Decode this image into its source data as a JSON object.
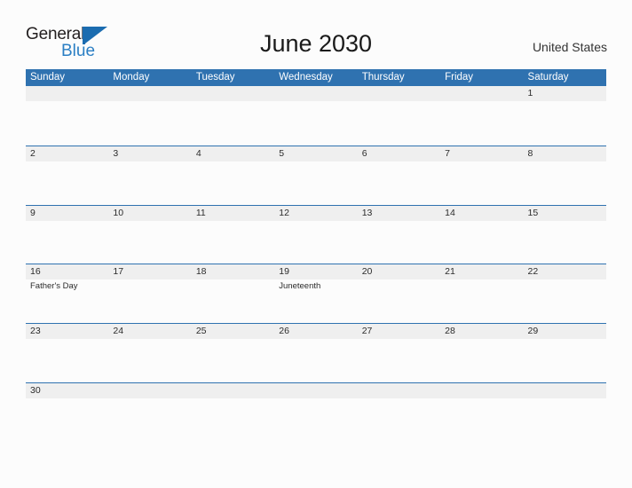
{
  "brand": {
    "name_part1": "General",
    "name_part2": "Blue",
    "mark": "triangle-flag-logo"
  },
  "header": {
    "title": "June 2030",
    "country": "United States"
  },
  "colors": {
    "header_blue": "#2f72b0",
    "row_line_blue": "#2f72b0",
    "daynum_band_gray": "#efefef",
    "logo_blue": "#2b7fc4",
    "page_background": "#fcfcfc",
    "text_dark": "#2b2b2b"
  },
  "calendar": {
    "month": "June",
    "year": "2030",
    "weekday_headers": [
      "Sunday",
      "Monday",
      "Tuesday",
      "Wednesday",
      "Thursday",
      "Friday",
      "Saturday"
    ],
    "weeks": [
      {
        "days": [
          {
            "num": "",
            "events": []
          },
          {
            "num": "",
            "events": []
          },
          {
            "num": "",
            "events": []
          },
          {
            "num": "",
            "events": []
          },
          {
            "num": "",
            "events": []
          },
          {
            "num": "",
            "events": []
          },
          {
            "num": "1",
            "events": []
          }
        ]
      },
      {
        "days": [
          {
            "num": "2",
            "events": []
          },
          {
            "num": "3",
            "events": []
          },
          {
            "num": "4",
            "events": []
          },
          {
            "num": "5",
            "events": []
          },
          {
            "num": "6",
            "events": []
          },
          {
            "num": "7",
            "events": []
          },
          {
            "num": "8",
            "events": []
          }
        ]
      },
      {
        "days": [
          {
            "num": "9",
            "events": []
          },
          {
            "num": "10",
            "events": []
          },
          {
            "num": "11",
            "events": []
          },
          {
            "num": "12",
            "events": []
          },
          {
            "num": "13",
            "events": []
          },
          {
            "num": "14",
            "events": []
          },
          {
            "num": "15",
            "events": []
          }
        ]
      },
      {
        "days": [
          {
            "num": "16",
            "events": [
              "Father's Day"
            ]
          },
          {
            "num": "17",
            "events": []
          },
          {
            "num": "18",
            "events": []
          },
          {
            "num": "19",
            "events": [
              "Juneteenth"
            ]
          },
          {
            "num": "20",
            "events": []
          },
          {
            "num": "21",
            "events": []
          },
          {
            "num": "22",
            "events": []
          }
        ]
      },
      {
        "days": [
          {
            "num": "23",
            "events": []
          },
          {
            "num": "24",
            "events": []
          },
          {
            "num": "25",
            "events": []
          },
          {
            "num": "26",
            "events": []
          },
          {
            "num": "27",
            "events": []
          },
          {
            "num": "28",
            "events": []
          },
          {
            "num": "29",
            "events": []
          }
        ]
      },
      {
        "days": [
          {
            "num": "30",
            "events": []
          },
          {
            "num": "",
            "events": []
          },
          {
            "num": "",
            "events": []
          },
          {
            "num": "",
            "events": []
          },
          {
            "num": "",
            "events": []
          },
          {
            "num": "",
            "events": []
          },
          {
            "num": "",
            "events": []
          }
        ]
      }
    ]
  }
}
